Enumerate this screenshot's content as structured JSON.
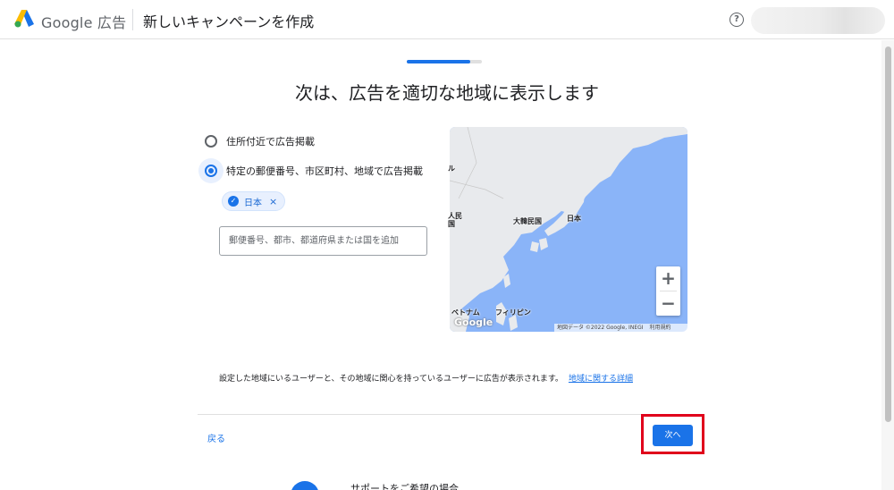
{
  "header": {
    "brand_google": "Google",
    "brand_product": "広告",
    "page_title": "新しいキャンペーンを作成",
    "help_glyph": "?"
  },
  "progress": {
    "fraction": 0.85
  },
  "main": {
    "title": "次は、広告を適切な地域に表示します",
    "options": [
      {
        "label": "住所付近で広告掲載",
        "selected": false
      },
      {
        "label": "特定の郵便番号、市区町村、地域で広告掲載",
        "selected": true
      }
    ],
    "chip": {
      "label": "日本",
      "close": "×"
    },
    "location_input": {
      "placeholder": "郵便番号、都市、都道府県または国を追加",
      "value": ""
    },
    "map": {
      "labels": {
        "korea": "大韓民国",
        "japan": "日本",
        "vietnam": "ベトナム",
        "philippines": "フィリピン",
        "china_partial": "人民\n国",
        "mongolia_partial": "ル"
      },
      "zoom_in": "+",
      "zoom_out": "−",
      "watermark": "Google",
      "attribution": "地図データ ©2022 Google, INEGI",
      "terms": "利用規約"
    },
    "info_text": "設定した地域にいるユーザーと、その地域に関心を持っているユーザーに広告が表示されます。",
    "info_link": "地域に関する詳細"
  },
  "footer": {
    "back_label": "戻る",
    "next_label": "次へ"
  },
  "support": {
    "text": "サポートをご希望の場合"
  },
  "colors": {
    "accent": "#1a73e8",
    "highlight": "#e0001b",
    "map_water": "#8ab4f8",
    "map_land": "#e8eaed"
  }
}
